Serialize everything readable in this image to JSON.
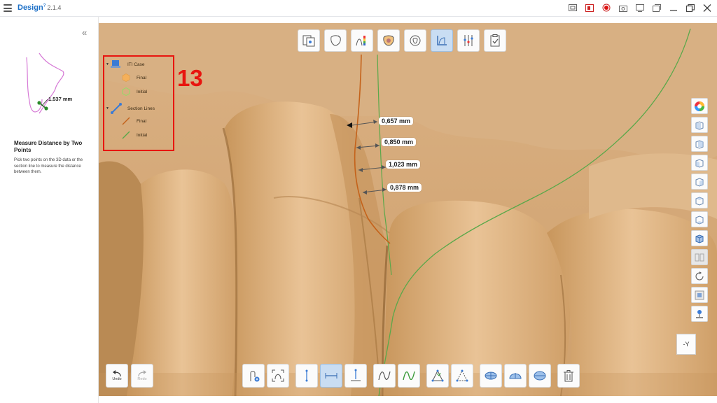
{
  "app": {
    "name": "Design",
    "superscript": "?",
    "version": "2.1.4"
  },
  "window_controls": [
    "screen-capture-icon",
    "video-icon",
    "record-icon",
    "camera-icon",
    "fullscreen-icon",
    "window-icon",
    "minimize-icon",
    "restore-icon",
    "close-icon"
  ],
  "left_panel": {
    "collapse_glyph": "«",
    "illustration_value": "1.537 mm",
    "tool_title": "Measure Distance by Two Points",
    "tool_description": "Pick two points on the 3D data or the section line to measure the distance between them."
  },
  "legend": {
    "groups": [
      {
        "label": "ITI Case",
        "items": [
          {
            "label": "Final",
            "color": "#f5b05a"
          },
          {
            "label": "Initial",
            "color": "#9ed46a"
          }
        ]
      },
      {
        "label": "Section Lines",
        "items": [
          {
            "label": "Final",
            "color": "#c4621a"
          },
          {
            "label": "Initial",
            "color": "#5aa84a"
          }
        ]
      }
    ]
  },
  "annotation": "13",
  "measurements": [
    "0,657 mm",
    "0,850 mm",
    "1,023 mm",
    "0,878 mm"
  ],
  "top_toolbar": [
    "align-data-icon",
    "deviation-icon",
    "color-map-icon",
    "tooth-icon",
    "rotate-model-icon",
    "section-view-icon",
    "measure-tools-icon",
    "checklist-icon"
  ],
  "right_toolbar": [
    "color-wheel-icon",
    "front-view-icon",
    "back-view-icon",
    "left-view-icon",
    "right-view-icon",
    "top-view-icon",
    "bottom-view-icon",
    "iso-view-icon",
    "split-view-icon",
    "reset-rotation-icon",
    "transparency-icon",
    "pin-icon"
  ],
  "view_cube_label": "-Y",
  "undo_label": "Undo",
  "redo_label": "Redo",
  "bottom_toolbar": [
    "add-section-icon",
    "section-frame-icon",
    "vertical-distance-icon",
    "horizontal-distance-icon",
    "perpendicular-distance-icon",
    "curve-length-icon",
    "curve-measure-icon",
    "angle-icon",
    "triangle-angle-icon",
    "area-icon",
    "cross-area-icon",
    "plane-area-icon",
    "delete-icon"
  ],
  "colors": {
    "accent": "#1b6fc7",
    "annotation": "#e8150f",
    "model": "#d3a876",
    "final_line": "#c4621a",
    "initial_line": "#5aa84a"
  }
}
